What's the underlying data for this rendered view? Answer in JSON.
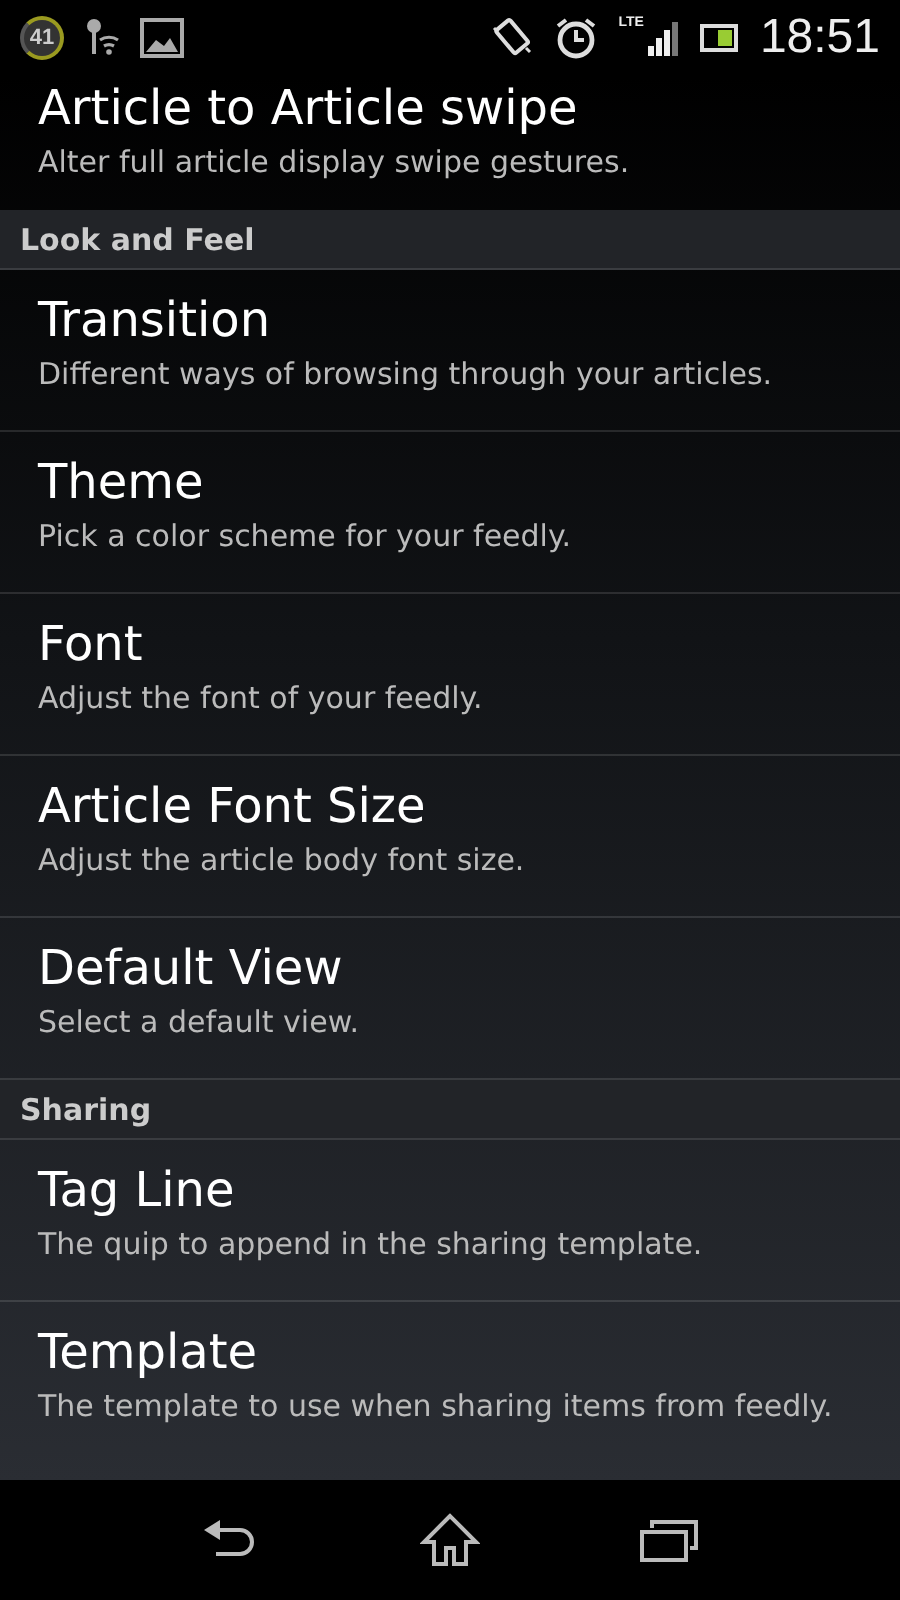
{
  "status_bar": {
    "badge": "41",
    "time": "18:51",
    "network": "LTE"
  },
  "preferences": [
    {
      "kind": "preference",
      "title": "Article to Article swipe",
      "summary": "Alter full article display swipe gestures."
    },
    {
      "kind": "category",
      "title": "Look and Feel"
    },
    {
      "kind": "preference",
      "title": "Transition",
      "summary": "Different ways of browsing through your articles."
    },
    {
      "kind": "preference",
      "title": "Theme",
      "summary": "Pick a color scheme for your feedly."
    },
    {
      "kind": "preference",
      "title": "Font",
      "summary": "Adjust the font of your feedly."
    },
    {
      "kind": "preference",
      "title": "Article Font Size",
      "summary": "Adjust the article body font size."
    },
    {
      "kind": "preference",
      "title": "Default View",
      "summary": "Select a default view."
    },
    {
      "kind": "category",
      "title": "Sharing"
    },
    {
      "kind": "preference",
      "title": "Tag Line",
      "summary": "The quip to append in the sharing template."
    },
    {
      "kind": "preference",
      "title": "Template",
      "summary": "The template to use when sharing items from feedly."
    }
  ]
}
